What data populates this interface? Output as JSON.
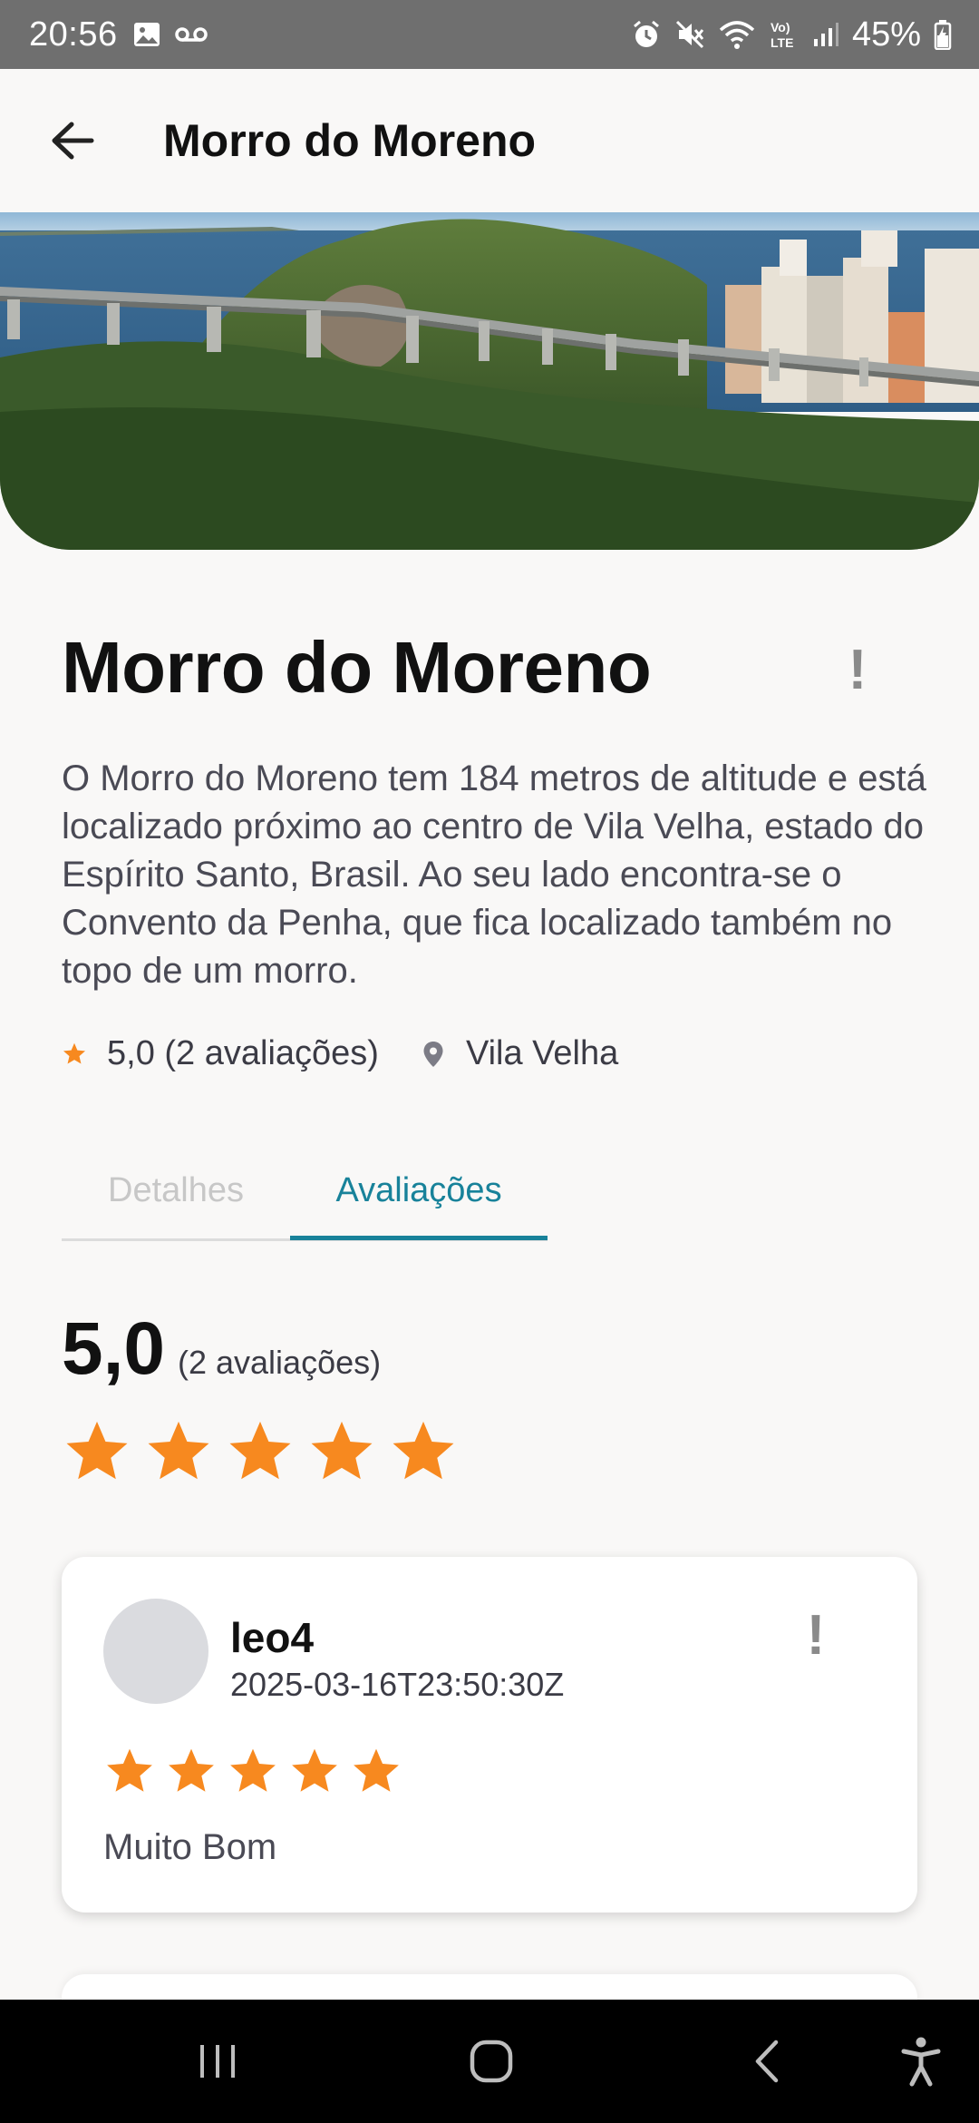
{
  "status_bar": {
    "time": "20:56",
    "battery": "45%",
    "icons": [
      "image-icon",
      "voicemail-icon",
      "alarm-icon",
      "mute-icon",
      "wifi-icon",
      "volte-icon",
      "signal-icon",
      "battery-icon"
    ]
  },
  "app_bar": {
    "title": "Morro do Moreno",
    "back_icon": "arrow-left-icon"
  },
  "place": {
    "title": "Morro do Moreno",
    "report_symbol": "!",
    "description": "O Morro do Moreno tem 184 metros de altitude e está localizado próximo ao centro de Vila Velha, estado do Espírito Santo, Brasil. Ao seu lado encontra-se o Convento da Penha, que fica localizado também no topo de um morro.",
    "rating_text": "5,0 (2 avaliações)",
    "location": "Vila Velha"
  },
  "tabs": [
    {
      "label": "Detalhes",
      "active": false
    },
    {
      "label": "Avaliações",
      "active": true
    }
  ],
  "summary": {
    "score": "5,0",
    "count": "(2 avaliações)",
    "stars": 5
  },
  "reviews": [
    {
      "user": "leo4",
      "date": "2025-03-16T23:50:30Z",
      "stars": 5,
      "text": "Muito Bom",
      "report_symbol": "!"
    }
  ],
  "colors": {
    "accent": "#18829a",
    "star": "#f7891f",
    "background": "#f9f8f7",
    "status_bar": "#6f6f6f"
  }
}
